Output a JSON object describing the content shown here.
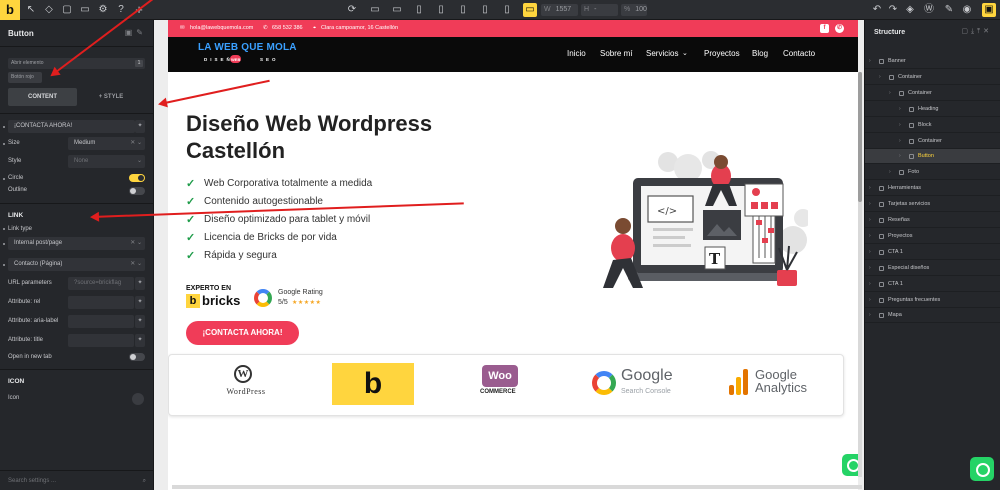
{
  "toolbar": {
    "logo": "b",
    "width_label": "W",
    "width_value": "1557",
    "height_label": "H",
    "height_value": "-",
    "zoom_label": "%",
    "zoom_value": "100"
  },
  "left_panel": {
    "title": "Button",
    "selector_1": "Abrir elemento",
    "selector_1_count": "1",
    "selector_2": "Botón rojo",
    "tabs": [
      "CONTENT",
      "STYLE"
    ],
    "text_value": "¡CONTACTA AHORA!",
    "size_label": "Size",
    "size_value": "Medium",
    "style_label": "Style",
    "style_value": "None",
    "circle_label": "Circle",
    "circle_on": true,
    "outline_label": "Outline",
    "outline_on": false,
    "link_section": "LINK",
    "link_type_label": "Link type",
    "link_type_value": "Internal post/page",
    "link_target_value": "Contacto (Página)",
    "url_params_label": "URL parameters",
    "url_params_placeholder": "?source=brickflag",
    "attr_rel_label": "Attribute: rel",
    "attr_aria_label": "Attribute: aria-label",
    "attr_title_label": "Attribute: title",
    "new_tab_label": "Open in new tab",
    "icon_section": "ICON",
    "icon_label": "Icon",
    "search_placeholder": "Search settings ..."
  },
  "structure": {
    "title": "Structure",
    "items": [
      {
        "label": "Banner",
        "depth": 0
      },
      {
        "label": "Container",
        "depth": 1
      },
      {
        "label": "Container",
        "depth": 2
      },
      {
        "label": "Heading",
        "depth": 3
      },
      {
        "label": "Block",
        "depth": 3
      },
      {
        "label": "Container",
        "depth": 3
      },
      {
        "label": "Button",
        "depth": 3,
        "selected": true
      },
      {
        "label": "Foto",
        "depth": 2
      },
      {
        "label": "Herramientas",
        "depth": 0
      },
      {
        "label": "Tarjetas servicios",
        "depth": 0
      },
      {
        "label": "Reseñas",
        "depth": 0
      },
      {
        "label": "Proyectos",
        "depth": 0
      },
      {
        "label": "CTA 1",
        "depth": 0
      },
      {
        "label": "Especial diseños",
        "depth": 0
      },
      {
        "label": "CTA 1",
        "depth": 0
      },
      {
        "label": "Preguntas frecuentes",
        "depth": 0
      },
      {
        "label": "Mapa",
        "depth": 0
      }
    ]
  },
  "site": {
    "email": "hola@lawebquemola.com",
    "phone": "658 532 386",
    "address": "Clara campoamor, 16 Castellón",
    "brand": "LA WEB QUE MOLA",
    "brand_sub_1": "DISEÑO",
    "brand_sub_2": "WEB",
    "brand_sub_3": "SEO",
    "menu": [
      "Inicio",
      "Sobre mí",
      "Servicios",
      "Proyectos",
      "Blog",
      "Contacto"
    ],
    "hero_title": "Diseño Web Wordpress Castellón",
    "features": [
      "Web Corporativa totalmente a medida",
      "Contenido autogestionable",
      "Diseño optimizado para tablet y móvil",
      "Licencia de Bricks de por vida",
      "Rápida y segura"
    ],
    "badge_line1": "EXPERTO EN",
    "badge_b": "b",
    "badge_line2": "bricks",
    "google_rating_label": "Google Rating",
    "google_rating_value": "5/5",
    "stars": "★★★★★",
    "cta": "¡CONTACTA AHORA!",
    "logo_wordpress": "WordPress",
    "logo_bricks": "b",
    "logo_woo": "Woo",
    "logo_woo_sub": "COMMERCE",
    "logo_google": "Google",
    "logo_google_sub": "Search Console",
    "logo_ga_1": "Google",
    "logo_ga_2": "Analytics",
    "illustration_tag": "</>",
    "illustration_t": "T"
  },
  "colors": {
    "accent": "#f03c58",
    "builder_yellow": "#ffd53e",
    "check_green": "#1f9c4a",
    "whatsapp": "#25d366",
    "annotation_red": "#e01e1e"
  }
}
